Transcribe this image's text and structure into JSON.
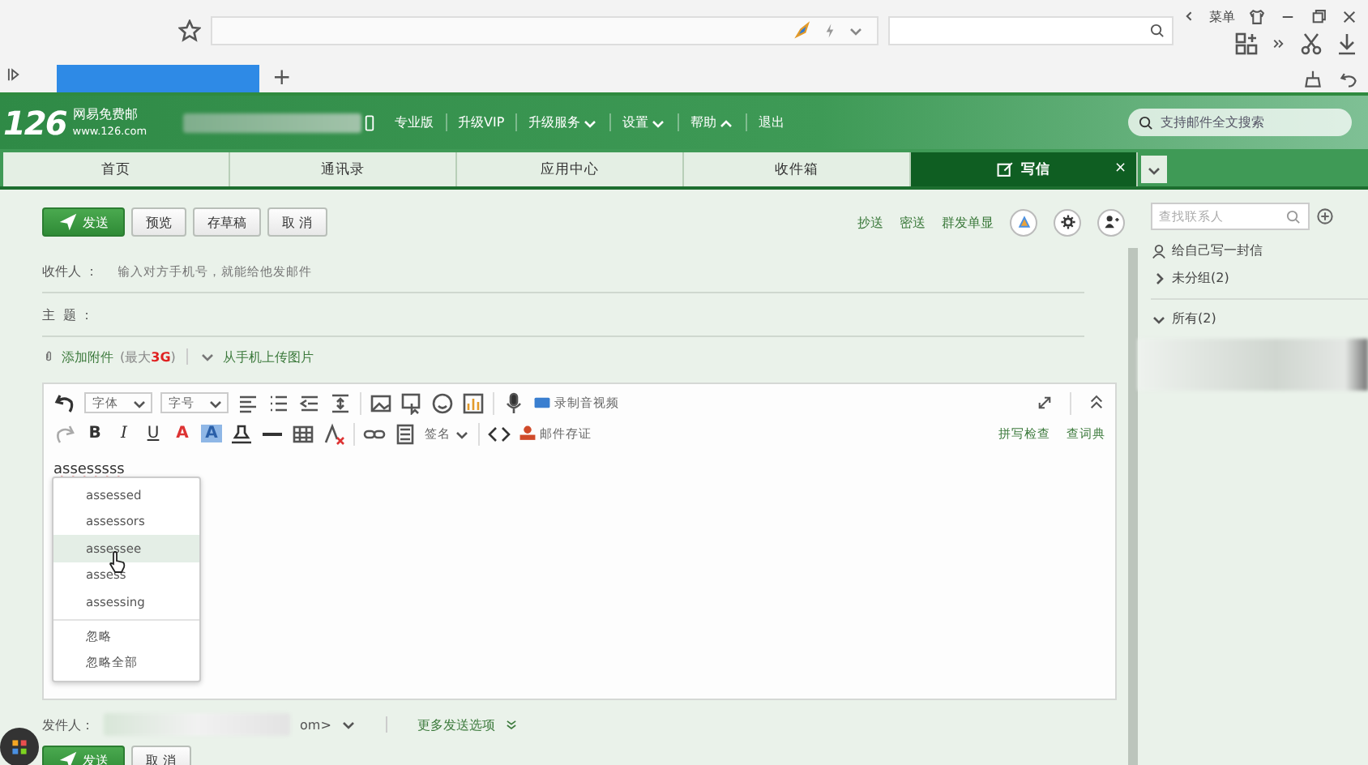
{
  "browser": {
    "menu_label": "菜单",
    "new_tab": "+"
  },
  "header": {
    "logo": "126",
    "brand": "网易免费邮",
    "domain": "www.126.com",
    "search_placeholder": "支持邮件全文搜索",
    "links": [
      {
        "label": "专业版",
        "kind": "link"
      },
      {
        "label": "升级VIP",
        "kind": "link"
      },
      {
        "label": "升级服务",
        "kind": "dropdown",
        "expanded": false
      },
      {
        "label": "设置",
        "kind": "dropdown",
        "expanded": false
      },
      {
        "label": "帮助",
        "kind": "dropdown",
        "expanded": true
      },
      {
        "label": "退出",
        "kind": "link"
      }
    ]
  },
  "tabs": [
    {
      "label": "首页",
      "selected": false
    },
    {
      "label": "通讯录",
      "selected": false
    },
    {
      "label": "应用中心",
      "selected": false
    },
    {
      "label": "收件箱",
      "selected": false
    },
    {
      "label": "写信",
      "selected": true,
      "close": "×"
    }
  ],
  "compose": {
    "actions": [
      {
        "label": "发送",
        "kind": "primary"
      },
      {
        "label": "预览",
        "kind": "default"
      },
      {
        "label": "存草稿",
        "kind": "default"
      },
      {
        "label": "取 消",
        "kind": "default"
      }
    ],
    "recipient_links": [
      "抄送",
      "密送",
      "群发单显"
    ],
    "to_label": "收件人 ：",
    "to_placeholder": "输入对方手机号，就能给他发邮件",
    "subject_label": "主  题 ：",
    "attach_label": "添加附件",
    "attach_limit": "(最大**3G**)",
    "upload_phone": "从手机上传图片"
  },
  "editor": {
    "font_select": "字体",
    "size_select": "字号",
    "record_label": "录制音视频",
    "format_glyphs": [
      {
        "label": "B",
        "kind": "bold"
      },
      {
        "label": "I",
        "kind": "italic"
      },
      {
        "label": "U",
        "kind": "underline"
      },
      {
        "label": "A",
        "kind": "font-color"
      },
      {
        "label": "A",
        "kind": "back-color"
      }
    ],
    "signature": "签名",
    "certify": "邮件存证",
    "spell_check": "拼写检查",
    "dictionary": "查词典",
    "text": "assesssss",
    "misspelled": true
  },
  "suggestions": {
    "items": [
      {
        "label": "assessed",
        "selected": false
      },
      {
        "label": "assessors",
        "selected": false
      },
      {
        "label": "assessee",
        "selected": true
      },
      {
        "label": "assess",
        "selected": false
      },
      {
        "label": "assessing",
        "selected": false
      }
    ],
    "actions": [
      "忽略",
      "忽略全部"
    ]
  },
  "footer": {
    "sender_label": "发件人：",
    "sender_tail": "om>",
    "more_options": "更多发送选项",
    "actions": [
      {
        "label": "发送",
        "kind": "primary"
      },
      {
        "label": "取 消",
        "kind": "default"
      }
    ]
  },
  "sidebar": {
    "search_placeholder": "查找联系人",
    "write_self": "给自己写一封信",
    "groups": [
      {
        "label": "未分组(2)",
        "expanded": false
      },
      {
        "label": "所有(2)",
        "expanded": true
      }
    ]
  }
}
